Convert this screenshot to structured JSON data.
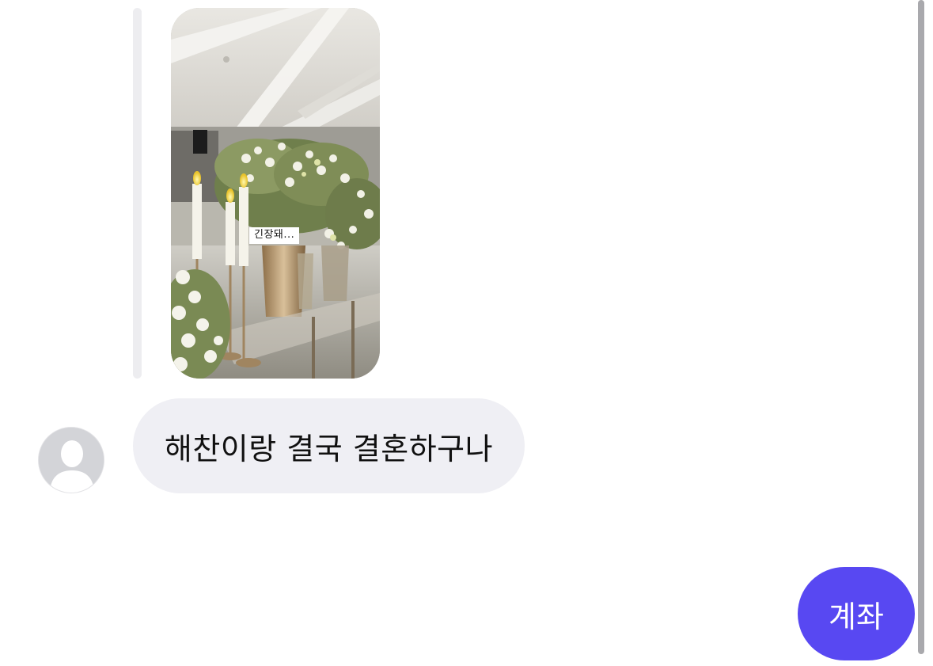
{
  "colors": {
    "incoming_bubble": "#efeff4",
    "outgoing_bubble": "#5848f2",
    "reply_bar": "#ededf0",
    "scrollbar": "#a9a9ad"
  },
  "messages": [
    {
      "type": "story_reply",
      "direction": "incoming",
      "story": {
        "image": "wedding-venue-flowers-candles",
        "sticker_text": "긴장돼..."
      }
    },
    {
      "type": "text",
      "direction": "incoming",
      "sender_avatar": "default-user-avatar",
      "text": "해찬이랑 결국 결혼하구나"
    },
    {
      "type": "text",
      "direction": "outgoing",
      "text": "계좌"
    }
  ]
}
